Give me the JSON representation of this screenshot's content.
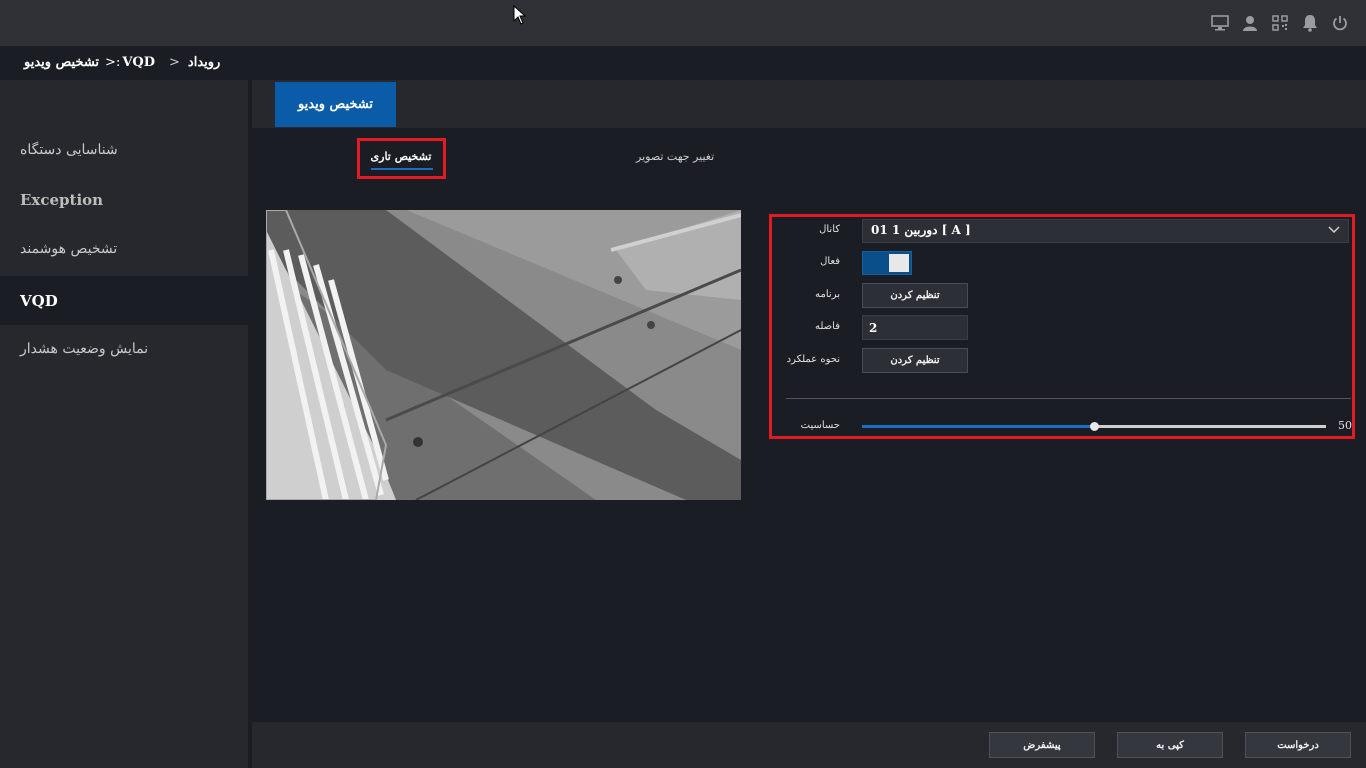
{
  "breadcrumb": {
    "item1": "رویداد",
    "item2": "VQD",
    "item3": "تشخیص ویدیو",
    "sep": ">",
    "sep2": ">:"
  },
  "top_icons": [
    "monitor-icon",
    "user-icon",
    "qr-code-icon",
    "alarm-bell-icon",
    "power-icon"
  ],
  "sidebar": {
    "items": [
      {
        "label": "شناسایی دستگاه",
        "active": false
      },
      {
        "label": "Exception",
        "active": false
      },
      {
        "label": "تشخیص هوشمند",
        "active": false
      },
      {
        "label": "VQD",
        "active": true
      },
      {
        "label": "نمایش وضعیت هشدار",
        "active": false
      }
    ]
  },
  "main_tab": {
    "label": "تشخیص ویدیو"
  },
  "sub_tabs": {
    "blur": "تشخیص تاری",
    "orientation": "تغییر جهت تصویر"
  },
  "form": {
    "channel_label": "کانال",
    "channel_value": "دوربین 1 01 [ A ]",
    "enable_label": "فعال",
    "enable_on": true,
    "schedule_label": "برنامه",
    "schedule_button": "تنظیم کردن",
    "interval_label": "فاصله",
    "interval_value": "2",
    "action_label": "نحوه عملکرد",
    "action_button": "تنظیم کردن",
    "sensitivity_label": "حساسیت",
    "sensitivity_value": "50"
  },
  "footer": {
    "default_button": "پیشفرض",
    "copy_button": "کپی به",
    "apply_button": "درخواست"
  },
  "colors": {
    "accent": "#0a5ba8",
    "highlight_box": "#e21b23",
    "background": "#1b1d24",
    "sidebar": "#26282e"
  }
}
